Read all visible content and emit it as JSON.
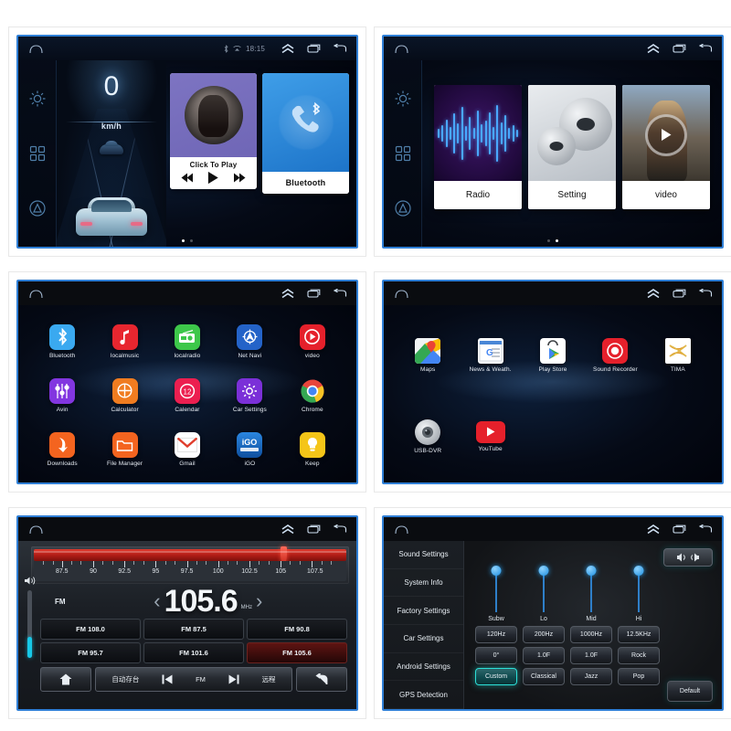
{
  "statusbar": {
    "time": "18:15",
    "icons": [
      "home-icon",
      "bluetooth-status-icon",
      "wifi-icon",
      "chevron-up-icon",
      "recents-icon",
      "back-icon"
    ]
  },
  "rail": {
    "items": [
      {
        "name": "gear-icon",
        "label": "Settings"
      },
      {
        "name": "apps-grid-icon",
        "label": "Apps"
      },
      {
        "name": "assistant-icon",
        "label": "Assistant"
      }
    ]
  },
  "panel1": {
    "speedometer": {
      "value": "0",
      "unit": "km/h"
    },
    "music_tile": {
      "caption": "Click To Play",
      "prev": "prev-track-icon",
      "play": "play-icon",
      "next": "next-track-icon"
    },
    "bluetooth_tile": {
      "caption": "Bluetooth"
    },
    "page_dots": 2,
    "active_dot": 0
  },
  "panel2": {
    "tiles": [
      {
        "caption": "Radio",
        "art": "audio-waveform"
      },
      {
        "caption": "Setting",
        "art": "gears"
      },
      {
        "caption": "video",
        "art": "movie-still"
      }
    ],
    "page_dots": 2,
    "active_dot": 1
  },
  "panel3": {
    "apps": [
      {
        "label": "Bluetooth",
        "icon": "bluetooth-icon",
        "color": "#3aa9f0"
      },
      {
        "label": "localmusic",
        "icon": "music-note-icon",
        "color": "#e8262f"
      },
      {
        "label": "localradio",
        "icon": "radio-icon",
        "color": "#3dc74a"
      },
      {
        "label": "Net Navi",
        "icon": "compass-icon",
        "color": "#2463c8"
      },
      {
        "label": "video",
        "icon": "play-circle-icon",
        "color": "#e5202b"
      },
      {
        "label": "Avin",
        "icon": "sliders-icon",
        "color": "#8236e0"
      },
      {
        "label": "Calculator",
        "icon": "calculator-icon",
        "color": "#f07c20"
      },
      {
        "label": "Calendar",
        "icon": "calendar-12-icon",
        "color": "#ec1f50"
      },
      {
        "label": "Car Settings",
        "icon": "gear-icon",
        "color": "#7b30d8"
      },
      {
        "label": "Chrome",
        "icon": "chrome-icon",
        "color": "#ffffff"
      },
      {
        "label": "Downloads",
        "icon": "download-arrow-icon",
        "color": "#f4641f"
      },
      {
        "label": "File Manager",
        "icon": "folder-icon",
        "color": "#f4641f"
      },
      {
        "label": "Gmail",
        "icon": "envelope-icon",
        "color": "#ffffff"
      },
      {
        "label": "iGO",
        "icon": "igo-icon",
        "color": "#1668c4"
      },
      {
        "label": "Keep",
        "icon": "lightbulb-icon",
        "color": "#f5c518"
      }
    ]
  },
  "panel4": {
    "apps": [
      {
        "label": "Maps",
        "icon": "maps-pin-icon",
        "color": "#ffffff"
      },
      {
        "label": "News & Weath.",
        "icon": "news-icon",
        "color": "#ffffff"
      },
      {
        "label": "Play Store",
        "icon": "play-store-icon",
        "color": "#ffffff"
      },
      {
        "label": "Sound Recorder",
        "icon": "record-icon",
        "color": "#e5202b"
      },
      {
        "label": "TIMA",
        "icon": "tima-icon",
        "color": "#ffffff"
      },
      {
        "label": "USB-DVR",
        "icon": "dvr-lens-icon",
        "color": "#b9bec4"
      },
      {
        "label": "YouTube",
        "icon": "youtube-icon",
        "color": "#e5202b"
      }
    ]
  },
  "panel5": {
    "band": "FM",
    "frequency": "105.6",
    "unit": "MHz",
    "scale_labels": [
      "87.5",
      "90",
      "92.5",
      "95",
      "97.5",
      "100",
      "102.5",
      "105",
      "107.5"
    ],
    "needle_position_pct": 80,
    "prev_icon": "chevron-left-icon",
    "next_icon": "chevron-right-icon",
    "volume_icon": "volume-icon",
    "presets": [
      {
        "label": "FM 108.0",
        "active": false
      },
      {
        "label": "FM 87.5",
        "active": false
      },
      {
        "label": "FM 90.8",
        "active": false
      },
      {
        "label": "FM 95.7",
        "active": false
      },
      {
        "label": "FM 101.6",
        "active": false
      },
      {
        "label": "FM 105.6",
        "active": true
      }
    ],
    "bottom": {
      "home": "home-icon",
      "autostore": "自动存台",
      "prev": "prev-track-icon",
      "band": "FM",
      "next": "next-track-icon",
      "remote": "远程",
      "back": "back-arrow-icon"
    }
  },
  "panel6": {
    "nav": [
      "Sound Settings",
      "System Info",
      "Factory Settings",
      "Car Settings",
      "Android Settings",
      "GPS Detection"
    ],
    "balance_button": "balance-speakers-icon",
    "sliders": [
      {
        "label": "Subw",
        "value_pct": 100
      },
      {
        "label": "Lo",
        "value_pct": 100
      },
      {
        "label": "Mid",
        "value_pct": 100
      },
      {
        "label": "Hi",
        "value_pct": 100
      }
    ],
    "freq_row": [
      "120Hz",
      "200Hz",
      "1000Hz",
      "12.5KHz"
    ],
    "value_row": [
      "0°",
      "1.0F",
      "1.0F",
      "Rock"
    ],
    "preset_row": [
      {
        "label": "Custom",
        "active": true
      },
      {
        "label": "Classical",
        "active": false
      },
      {
        "label": "Jazz",
        "active": false
      },
      {
        "label": "Pop",
        "active": false
      }
    ],
    "default_button": "Default"
  },
  "colors": {
    "accent_blue": "#2f7fd6",
    "radio_red": "#b11d16",
    "teal_active": "#2de0d8",
    "volume_cyan": "#17c8e8"
  }
}
